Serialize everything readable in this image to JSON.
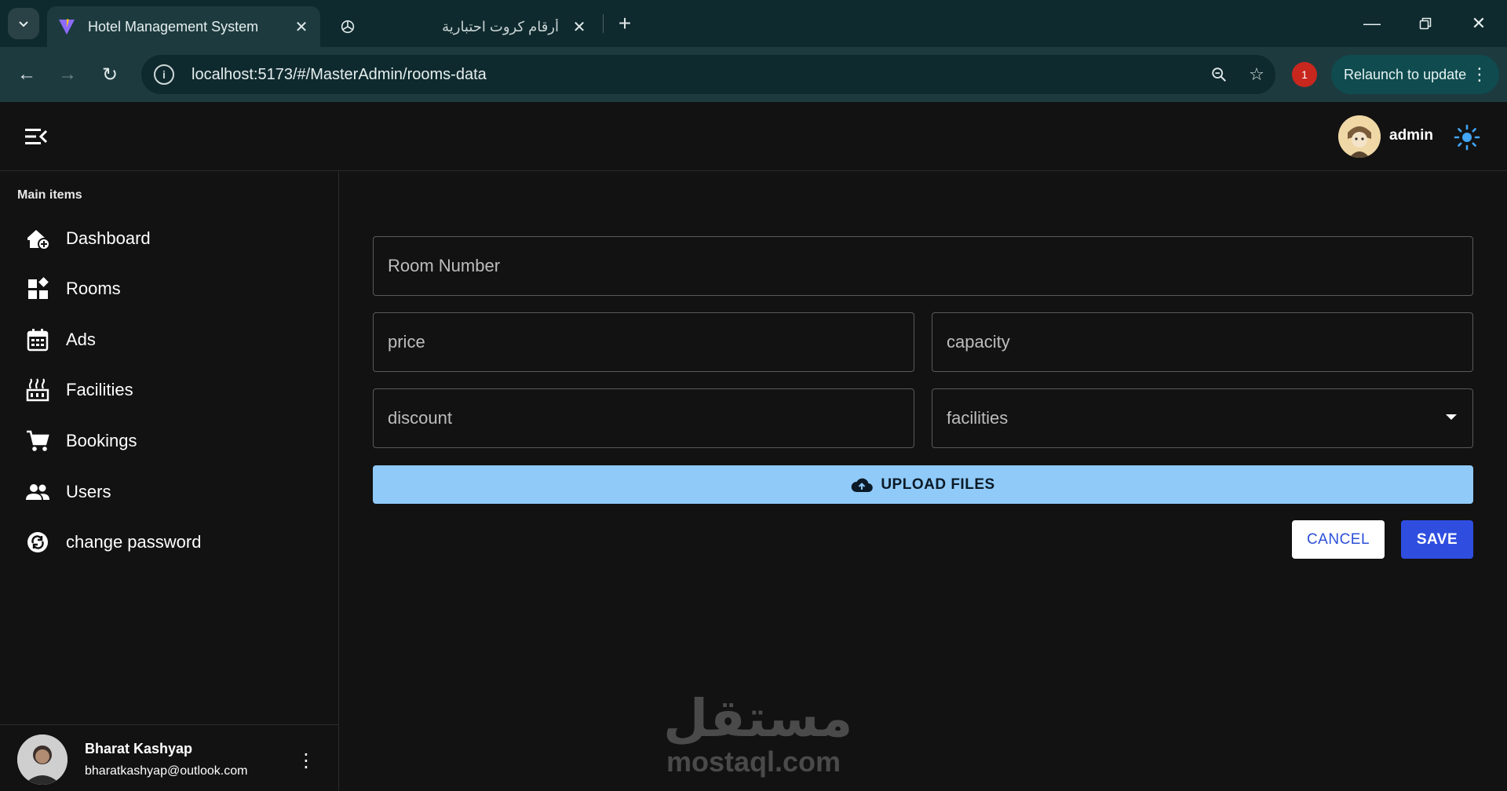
{
  "browser": {
    "tabs": [
      {
        "title": "Hotel Management System",
        "active": true
      },
      {
        "title": "أرقام كروت احتبارية",
        "active": false
      }
    ],
    "url": "localhost:5173/#/MasterAdmin/rooms-data",
    "extension_badge": "1",
    "relaunch_label": "Relaunch to update"
  },
  "appbar": {
    "user_name": "admin"
  },
  "sidebar": {
    "heading": "Main items",
    "items": [
      {
        "label": "Dashboard",
        "icon": "add-home-icon"
      },
      {
        "label": "Rooms",
        "icon": "widgets-icon"
      },
      {
        "label": "Ads",
        "icon": "calendar-icon"
      },
      {
        "label": "Facilities",
        "icon": "factory-icon"
      },
      {
        "label": "Bookings",
        "icon": "cart-icon"
      },
      {
        "label": "Users",
        "icon": "users-icon"
      },
      {
        "label": "change password",
        "icon": "sync-lock-icon"
      }
    ],
    "user": {
      "name": "Bharat Kashyap",
      "email": "bharatkashyap@outlook.com"
    }
  },
  "form": {
    "room_number_placeholder": "Room Number",
    "price_placeholder": "price",
    "capacity_placeholder": "capacity",
    "discount_placeholder": "discount",
    "facilities_label": "facilities",
    "upload_label": "UPLOAD FILES",
    "cancel_label": "CANCEL",
    "save_label": "SAVE"
  },
  "watermark": {
    "arabic": "مستقل",
    "latin": "mostaql.com"
  },
  "colors": {
    "upload": "#90caf9",
    "save": "#2f4ee0",
    "theme_icon": "#42a5f5",
    "chrome_bg": "#1d3b3f"
  }
}
